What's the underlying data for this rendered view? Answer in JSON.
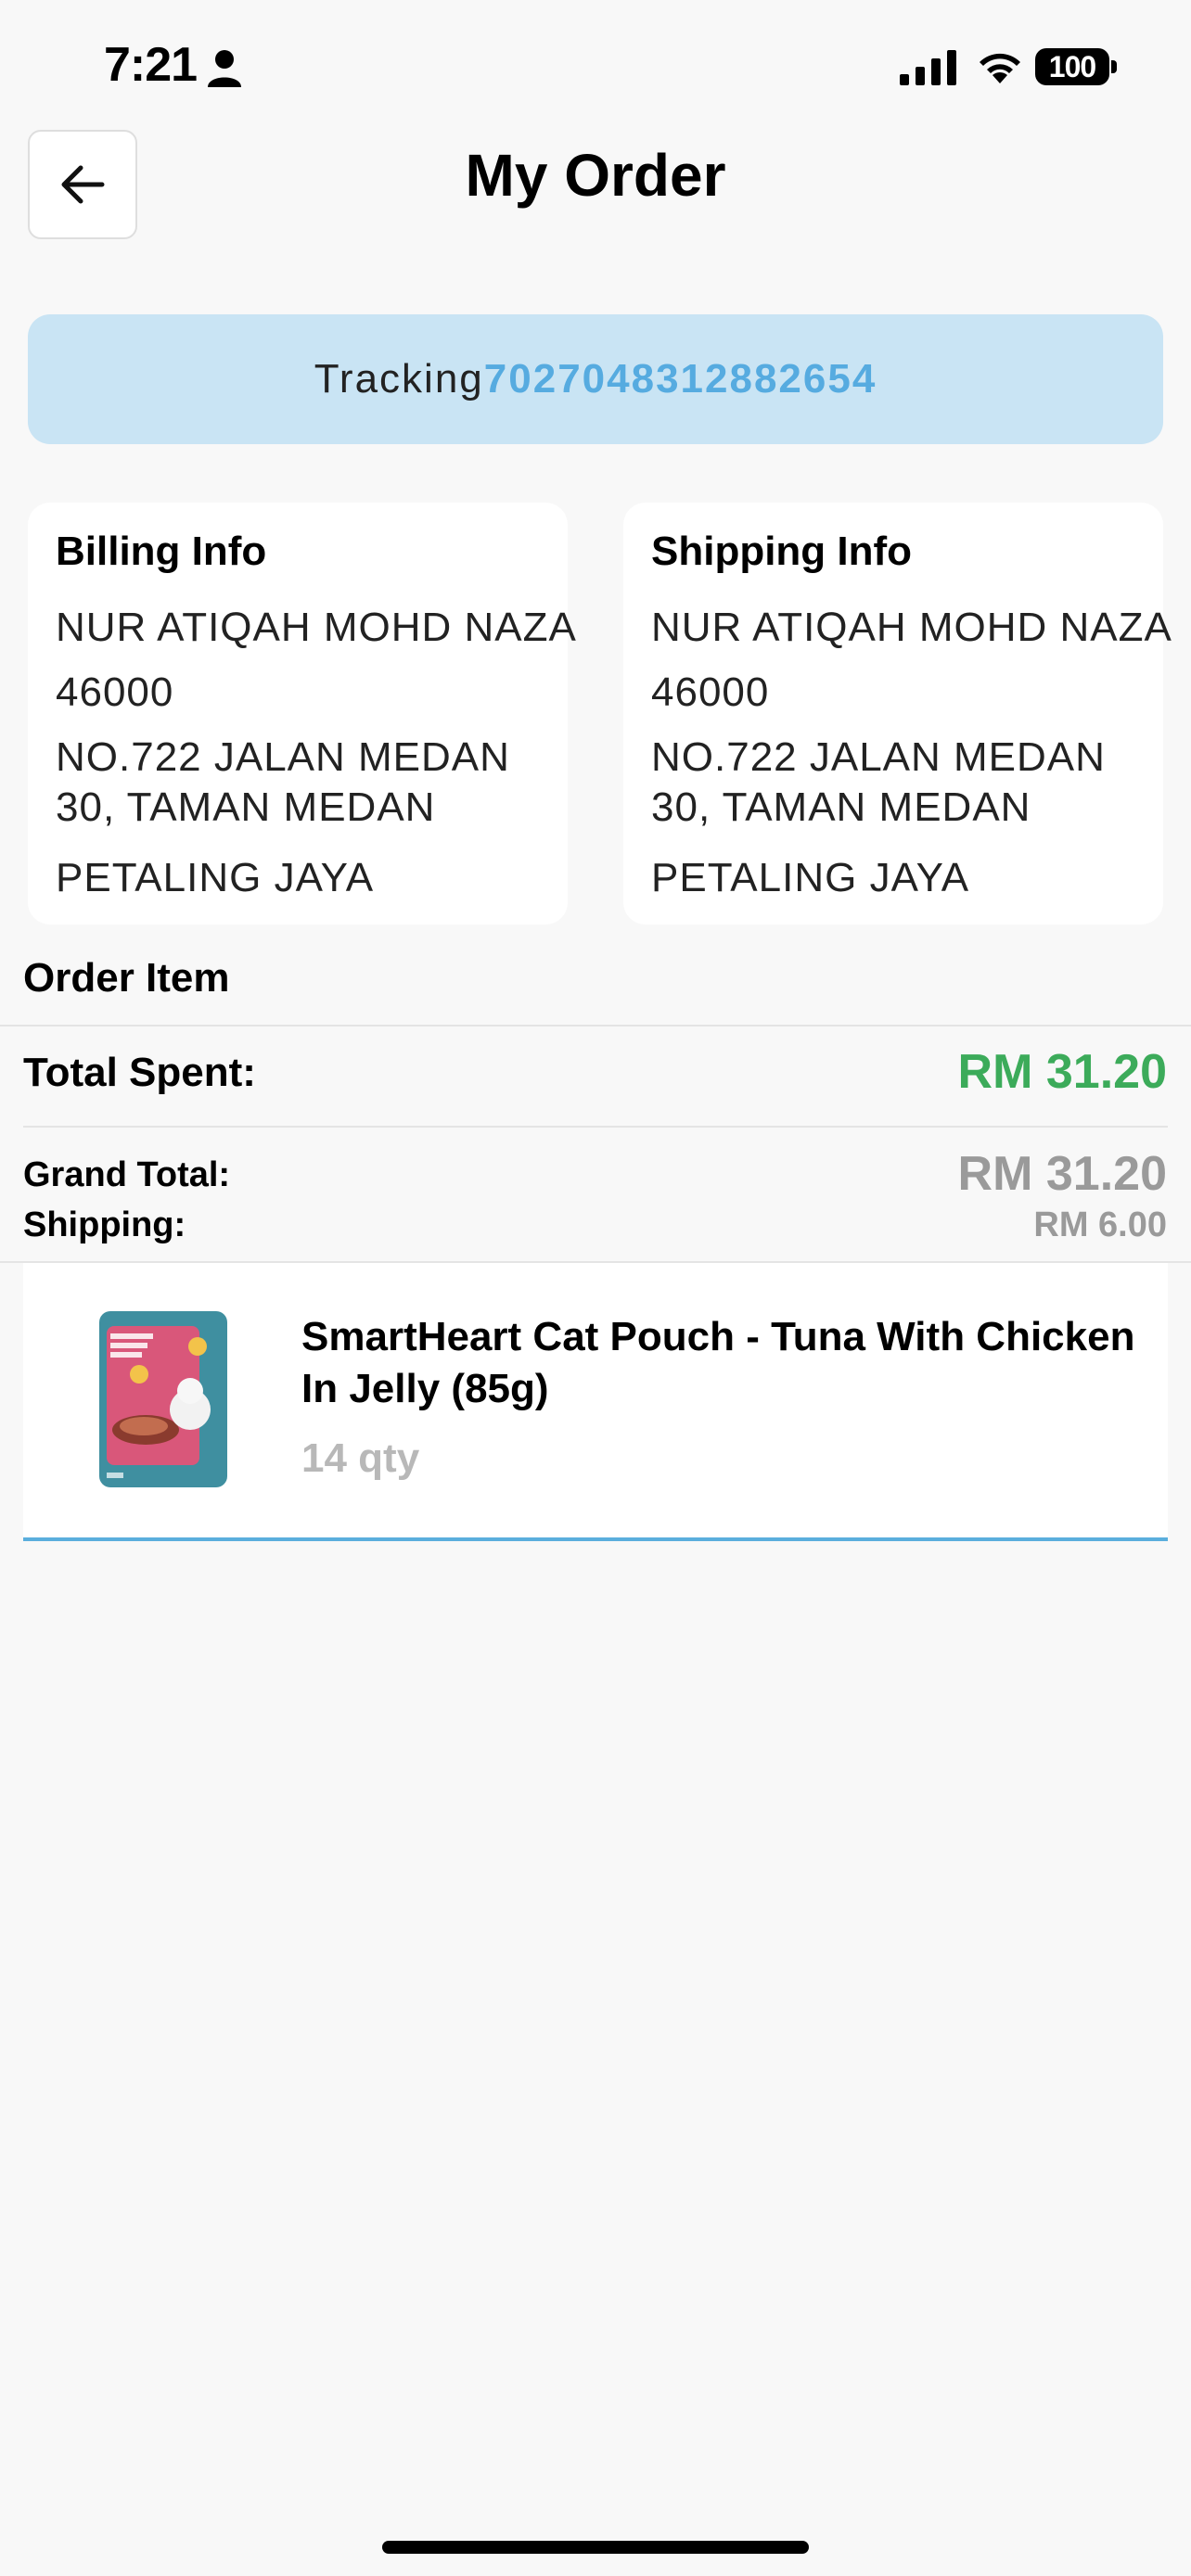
{
  "status_bar": {
    "time": "7:21",
    "battery": "100"
  },
  "header": {
    "title": "My Order"
  },
  "tracking": {
    "label": "Tracking",
    "number": "7027048312882654"
  },
  "billing": {
    "title": "Billing Info",
    "name": "NUR ATIQAH MOHD NAZA",
    "postcode": "46000",
    "address": "NO.722 JALAN MEDAN 30, TAMAN MEDAN",
    "city": "PETALING JAYA"
  },
  "shipping": {
    "title": "Shipping Info",
    "name": "NUR ATIQAH MOHD NAZA",
    "postcode": "46000",
    "address": "NO.722 JALAN MEDAN 30, TAMAN MEDAN",
    "city": "PETALING JAYA"
  },
  "order": {
    "section_title": "Order Item",
    "total_spent_label": "Total Spent:",
    "total_spent_value": "RM 31.20",
    "grand_total_label": "Grand Total:",
    "grand_total_value": "RM 31.20",
    "shipping_label": "Shipping:",
    "shipping_value": "RM 6.00",
    "items": [
      {
        "name": "SmartHeart Cat Pouch - Tuna With Chicken In Jelly (85g)",
        "qty": "14 qty"
      }
    ]
  },
  "colors": {
    "accent_blue": "#56abe0",
    "tracking_bg": "#c9e4f4",
    "total_green": "#3cab5a",
    "muted_gray": "#9a9a9a"
  },
  "icons": {
    "back": "arrow-left-icon",
    "person": "person-icon",
    "signal": "signal-icon",
    "wifi": "wifi-icon",
    "battery": "battery-icon"
  }
}
